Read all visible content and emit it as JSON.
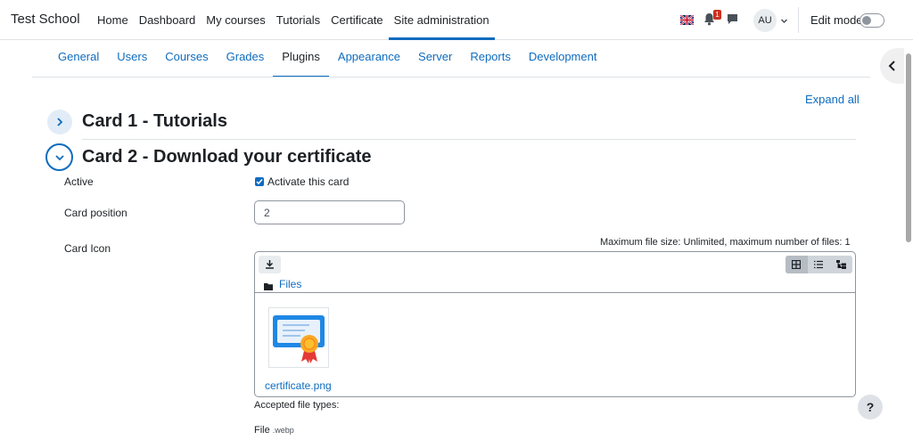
{
  "site": {
    "name": "Test School"
  },
  "primary_nav": [
    {
      "label": "Home"
    },
    {
      "label": "Dashboard"
    },
    {
      "label": "My courses"
    },
    {
      "label": "Tutorials"
    },
    {
      "label": "Certificate"
    },
    {
      "label": "Site administration",
      "active": true
    }
  ],
  "user": {
    "initials": "AU",
    "notification_count": "1",
    "edit_mode_label": "Edit mode",
    "edit_mode_on": false
  },
  "secondary_nav": [
    {
      "label": "General"
    },
    {
      "label": "Users"
    },
    {
      "label": "Courses"
    },
    {
      "label": "Grades"
    },
    {
      "label": "Plugins",
      "active": true
    },
    {
      "label": "Appearance"
    },
    {
      "label": "Server"
    },
    {
      "label": "Reports"
    },
    {
      "label": "Development"
    }
  ],
  "content": {
    "expand_all": "Expand all",
    "card1_title": "Card 1 - Tutorials",
    "card2_title": "Card 2 - Download your certificate",
    "active_label": "Active",
    "activate_checkbox_label": "Activate this card",
    "activate_checked": true,
    "position_label": "Card position",
    "position_value": "2",
    "icon_label": "Card Icon",
    "max_file_size": "Maximum file size: Unlimited, maximum number of files: 1",
    "files_path": "Files",
    "file_name": "certificate.png",
    "accepted_types_label": "Accepted file types:",
    "file_type_name": "File",
    "file_type_ext": ".webp"
  },
  "help": {
    "label": "?"
  },
  "colors": {
    "accent": "#0f6cbf",
    "badge": "#ca3120"
  },
  "icons": [
    "flag-uk-icon",
    "bell-icon",
    "message-icon",
    "chevron-down-icon",
    "chevron-left-icon",
    "chevron-right-icon",
    "download-icon",
    "grid-view-icon",
    "list-view-icon",
    "tree-view-icon",
    "folder-icon",
    "certificate-icon"
  ]
}
